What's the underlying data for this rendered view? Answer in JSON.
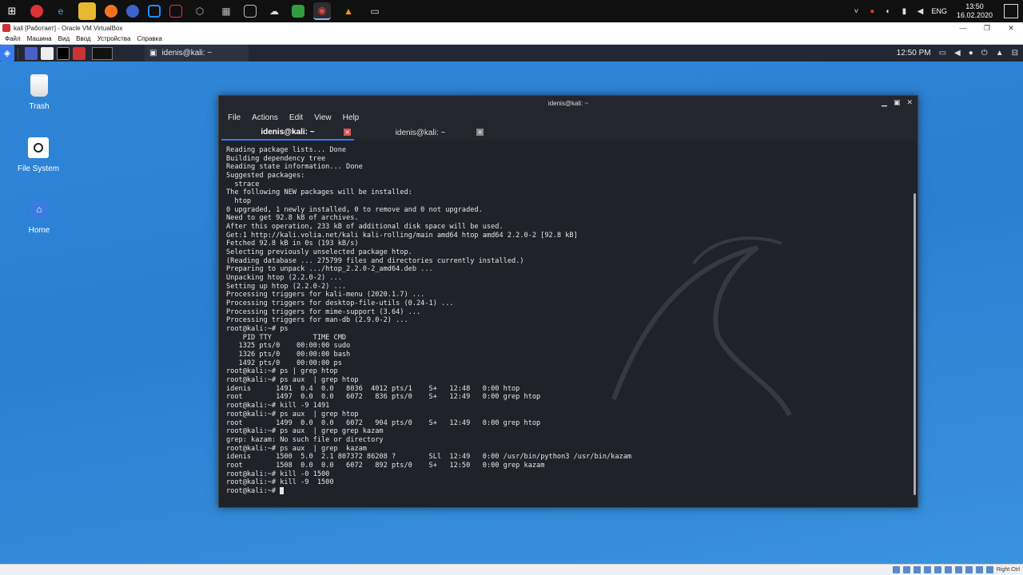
{
  "host_taskbar": {
    "tray": {
      "lang": "ENG",
      "time": "13:50",
      "date": "16.02.2020"
    }
  },
  "virtualbox": {
    "title": "kali [Работает] - Oracle VM VirtualBox",
    "menu": [
      "Файл",
      "Машина",
      "Вид",
      "Ввод",
      "Устройства",
      "Справка"
    ]
  },
  "kali_panel": {
    "task_title": "idenis@kali: ~",
    "time": "12:50 PM"
  },
  "desktop": {
    "icons": [
      "Trash",
      "File System",
      "Home"
    ]
  },
  "terminal": {
    "window_title": "idenis@kali: ~",
    "menu": [
      "File",
      "Actions",
      "Edit",
      "View",
      "Help"
    ],
    "tabs": [
      "idenis@kali: ~",
      "idenis@kali: ~"
    ],
    "lines": [
      "Reading package lists... Done",
      "Building dependency tree",
      "Reading state information... Done",
      "Suggested packages:",
      "  strace",
      "The following NEW packages will be installed:",
      "  htop",
      "0 upgraded, 1 newly installed, 0 to remove and 0 not upgraded.",
      "Need to get 92.8 kB of archives.",
      "After this operation, 233 kB of additional disk space will be used.",
      "Get:1 http://kali.volia.net/kali kali-rolling/main amd64 htop amd64 2.2.0-2 [92.8 kB]",
      "Fetched 92.8 kB in 0s (193 kB/s)",
      "Selecting previously unselected package htop.",
      "(Reading database ... 275799 files and directories currently installed.)",
      "Preparing to unpack .../htop_2.2.0-2_amd64.deb ...",
      "Unpacking htop (2.2.0-2) ...",
      "Setting up htop (2.2.0-2) ...",
      "Processing triggers for kali-menu (2020.1.7) ...",
      "Processing triggers for desktop-file-utils (0.24-1) ...",
      "Processing triggers for mime-support (3.64) ...",
      "Processing triggers for man-db (2.9.0-2) ...",
      "root@kali:~# ps",
      "    PID TTY          TIME CMD",
      "   1325 pts/0    00:00:00 sudo",
      "   1326 pts/0    00:00:00 bash",
      "   1492 pts/0    00:00:00 ps",
      "root@kali:~# ps | grep htop",
      "root@kali:~# ps aux  | grep htop",
      "idenis      1491  0.4  0.0   8036  4012 pts/1    S+   12:48   0:00 htop",
      "root        1497  0.0  0.0   6072   836 pts/0    S+   12:49   0:00 grep htop",
      "root@kali:~# kill -9 1491",
      "root@kali:~# ps aux  | grep htop",
      "root        1499  0.0  0.0   6072   904 pts/0    S+   12:49   0:00 grep htop",
      "root@kali:~# ps aux  | grep grep kazam",
      "grep: kazam: No such file or directory",
      "root@kali:~# ps aux  | grep  kazam",
      "idenis      1500  5.0  2.1 807372 86208 ?        SLl  12:49   0:00 /usr/bin/python3 /usr/bin/kazam",
      "root        1508  0.0  0.0   6072   892 pts/0    S+   12:50   0:00 grep kazam",
      "root@kali:~# kill -0 1500",
      "root@kali:~# kill -9  1500",
      "root@kali:~# "
    ]
  },
  "bottom_strip": {
    "host_key": "Right Ctrl"
  }
}
